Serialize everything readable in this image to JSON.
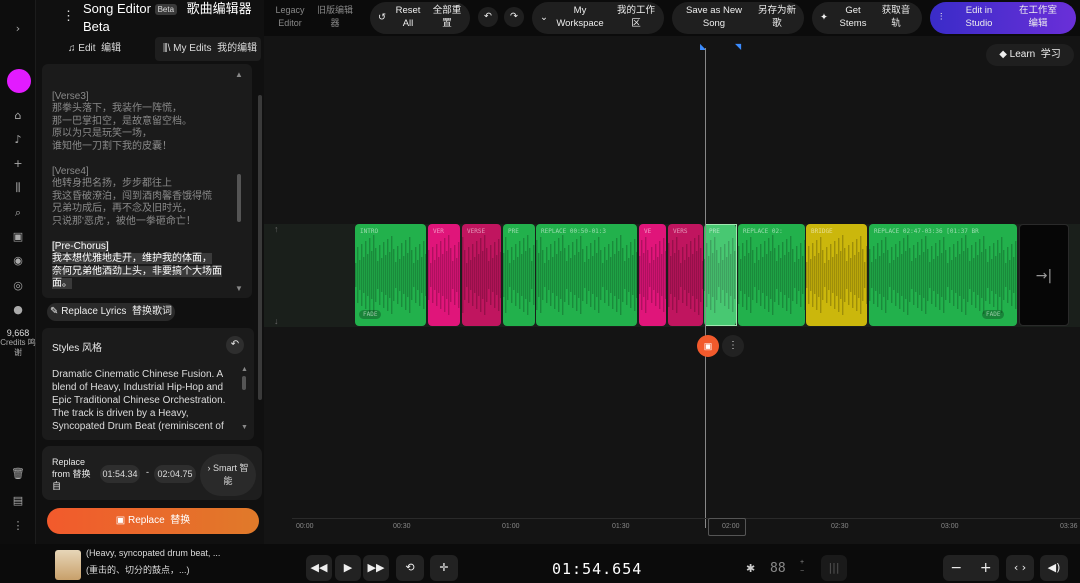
{
  "app": {
    "title": "Song Editor",
    "beta": "Beta",
    "title_zh": "歌曲编辑器",
    "title_line2": "Beta"
  },
  "top": {
    "legacy_en": "Legacy",
    "legacy_en2": "Editor",
    "legacy_zh": "旧版编辑",
    "legacy_zh2": "器",
    "reset_en": "Reset",
    "reset_en2": "All",
    "reset_zh": "全部重",
    "reset_zh2": "置",
    "ws_en": "My",
    "ws_en2": "Workspace",
    "ws_zh": "我的工作",
    "ws_zh2": "区",
    "save_en": "Save as New",
    "save_en2": "Song",
    "save_zh": "另存为新",
    "save_zh2": "歌",
    "stems_en": "Get",
    "stems_en2": "Stems",
    "stems_zh": "获取音",
    "stems_zh2": "轨",
    "studio_en": "Edit in",
    "studio_en2": "Studio",
    "studio_zh": "在工作室",
    "studio_zh2": "编辑",
    "learn": "Learn",
    "learn_zh": "学习"
  },
  "tabs": {
    "edit": "Edit",
    "edit_zh": "编辑",
    "myedits": "My Edits",
    "myedits_zh": "我的编辑"
  },
  "lyrics": {
    "v3": "[Verse3]",
    "v3l1": "那拳头落下，我装作一阵慌，",
    "v3l2": "那一巴掌扣空，是故意留空档。",
    "v3l3": "原以为只是玩笑一场，",
    "v3l4": "谁知他一刀割下我的皮囊！",
    "v4": "[Verse4]",
    "v4l1": "他转身把名扬，步步都往上",
    "v4l2": "我这昏破潦泊，闯到酒肉馨香饿得慌",
    "v4l3": "兄弟功成后，再不念及旧时光，",
    "v4l4": "只说那'恶虎'，被他一拳砸命亡！",
    "pc": "[Pre-Chorus]",
    "pcl1": "我本想优雅地走开，维护我的体面，",
    "pcl2": "奈何兄弟他酒劲上头，非要搞个大场面",
    "pcl3": "面。"
  },
  "replace_lyrics": "Replace Lyrics",
  "replace_lyrics_zh": "替换歌词",
  "styles": {
    "label": "Styles",
    "label_zh": "风格",
    "text": "Dramatic Cinematic Chinese Fusion. A blend of Heavy, Industrial Hip-Hop and Epic Traditional Chinese Orchestration. The track is driven by a Heavy, Syncopated Drum Beat (reminiscent of"
  },
  "replace": {
    "label": "Replace",
    "from": "from",
    "from_zh": "替换",
    "zh": "自",
    "start": "01:54.34",
    "dash": "-",
    "end": "02:04.75",
    "smart": "Smart",
    "smart_zh": "智",
    "smart_zh2": "能"
  },
  "replace_button": "Replace",
  "replace_button_zh": "替换",
  "credits": {
    "value": "9,668",
    "label": "Credits",
    "label_zh": "鸣",
    "label_zh2": "谢"
  },
  "clips": [
    {
      "label": "INTRO",
      "color": "#22b14c",
      "badge": "FADE"
    },
    {
      "label": "VER",
      "color": "#e0157a"
    },
    {
      "label": "VERSE",
      "color": "#c0155f"
    },
    {
      "label": "PRE",
      "color": "#22b14c"
    },
    {
      "label": "REPLACE 00:50-01:3",
      "color": "#22b14c"
    },
    {
      "label": "VE",
      "color": "#e0157a"
    },
    {
      "label": "VERS",
      "color": "#c0155f"
    },
    {
      "label": "PRE",
      "color": "#2fc15f"
    },
    {
      "label": "REPLACE 02:",
      "color": "#22b14c"
    },
    {
      "label": "BRIDGE",
      "color": "#cbb70c"
    },
    {
      "label": "REPLACE 02:47-03:36 [01:37 BR",
      "color": "#22b14c",
      "badge": "FADE"
    }
  ],
  "ruler": [
    "00:00",
    "00:30",
    "01:00",
    "01:30",
    "02:00",
    "02:30",
    "03:00",
    "03:36"
  ],
  "player": {
    "song_l1": "(Heavy, syncopated drum beat, ...",
    "song_l2": "(重击的、切分的鼓点，...)",
    "time": "01:54.654",
    "bpm": "88"
  }
}
